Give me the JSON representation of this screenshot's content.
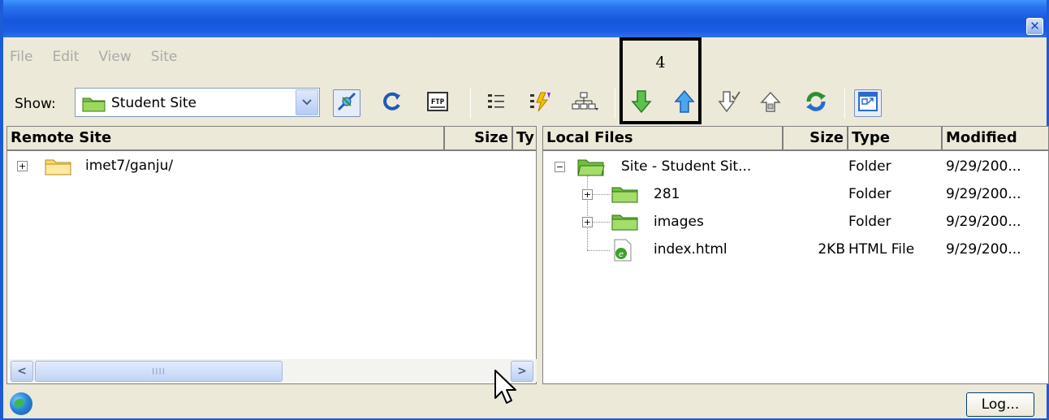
{
  "window": {
    "close_glyph": "✕"
  },
  "menu": [
    "File",
    "Edit",
    "View",
    "Site"
  ],
  "toolbar": {
    "show_label": "Show:",
    "site_select": "Student Site",
    "buttons": [
      "connect-icon",
      "refresh-icon",
      "ftp-log-icon",
      "file-view-icon",
      "testing-server-icon",
      "repository-icon",
      "get-files-icon",
      "put-files-icon",
      "check-out-icon",
      "check-in-icon",
      "synchronize-icon",
      "expand-icon"
    ],
    "ftp_text": "FTP"
  },
  "callout": {
    "number": "4"
  },
  "remote": {
    "headers": {
      "name": "Remote Site",
      "size": "Size",
      "type": "Ty"
    },
    "rows": [
      {
        "name": "imet7/ganju/"
      }
    ],
    "scroll_thumb_grip": "IIII"
  },
  "local": {
    "headers": {
      "name": "Local Files",
      "size": "Size",
      "type": "Type",
      "modified": "Modified"
    },
    "rows": [
      {
        "name": "Site - Student Sit...",
        "size": "",
        "type": "Folder",
        "modified": "9/29/200..."
      },
      {
        "name": "281",
        "size": "",
        "type": "Folder",
        "modified": "9/29/200..."
      },
      {
        "name": "images",
        "size": "",
        "type": "Folder",
        "modified": "9/29/200..."
      },
      {
        "name": "index.html",
        "size": "2KB",
        "type": "HTML File",
        "modified": "9/29/200..."
      }
    ]
  },
  "status": {
    "log_button": "Log..."
  },
  "colors": {
    "title_blue": "#1656dc",
    "chrome": "#ece9d8",
    "get_green": "#3aa63a",
    "put_blue": "#2a7bd8"
  }
}
